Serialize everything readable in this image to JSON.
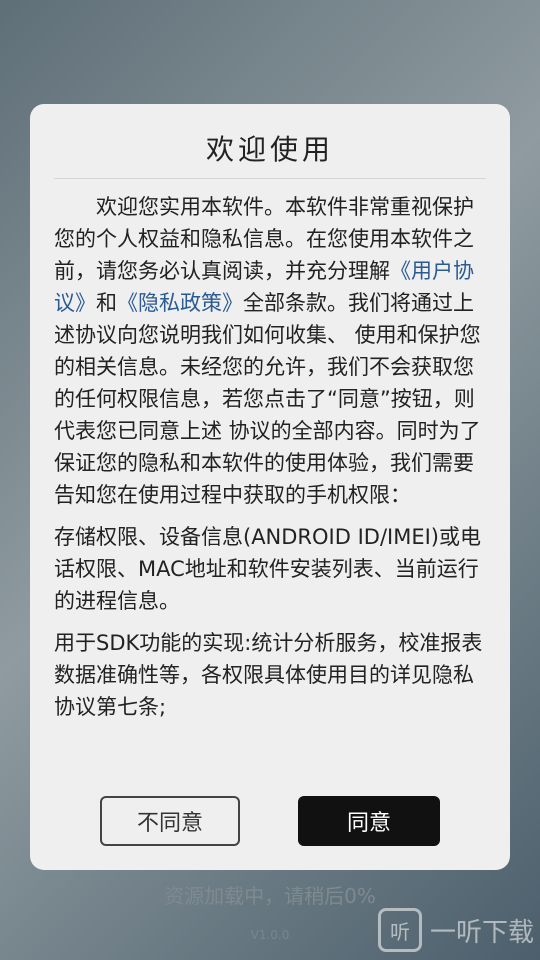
{
  "background": {
    "loading_text": "资源加载中，请稍后0%",
    "version": "V1.0.0",
    "watermark_icon": "听",
    "watermark_text": "一听下载"
  },
  "dialog": {
    "title": "欢迎使用",
    "p1_a": "欢迎您实用本软件。本软件非常重视保护您的个人权益和隐私信息。在您使用本软件之前，请您务必认真阅读，并充分理解",
    "link_user_agreement": "《用户协议》",
    "and": "和",
    "link_privacy_policy": "《隐私政策》",
    "p1_b": "全部条款。我们将通过上述协议向您说明我们如何收集、 使用和保护您的相关信息。未经您的允许，我们不会获取您的任何权限信息，若您点击了“同意”按钮，则代表您已同意上述 协议的全部内容。同时为了保证您的隐私和本软件的使用体验，我们需要告知您在使用过程中获取的手机权限：",
    "p2": "存储权限、设备信息(ANDROID ID/IMEI)或电话权限、MAC地址和软件安装列表、当前运行的进程信息。",
    "p3": "用于SDK功能的实现:统计分析服务，校准报表数据准确性等，各权限具体使用目的详见隐私协议第七条;",
    "disagree_label": "不同意",
    "agree_label": "同意"
  }
}
